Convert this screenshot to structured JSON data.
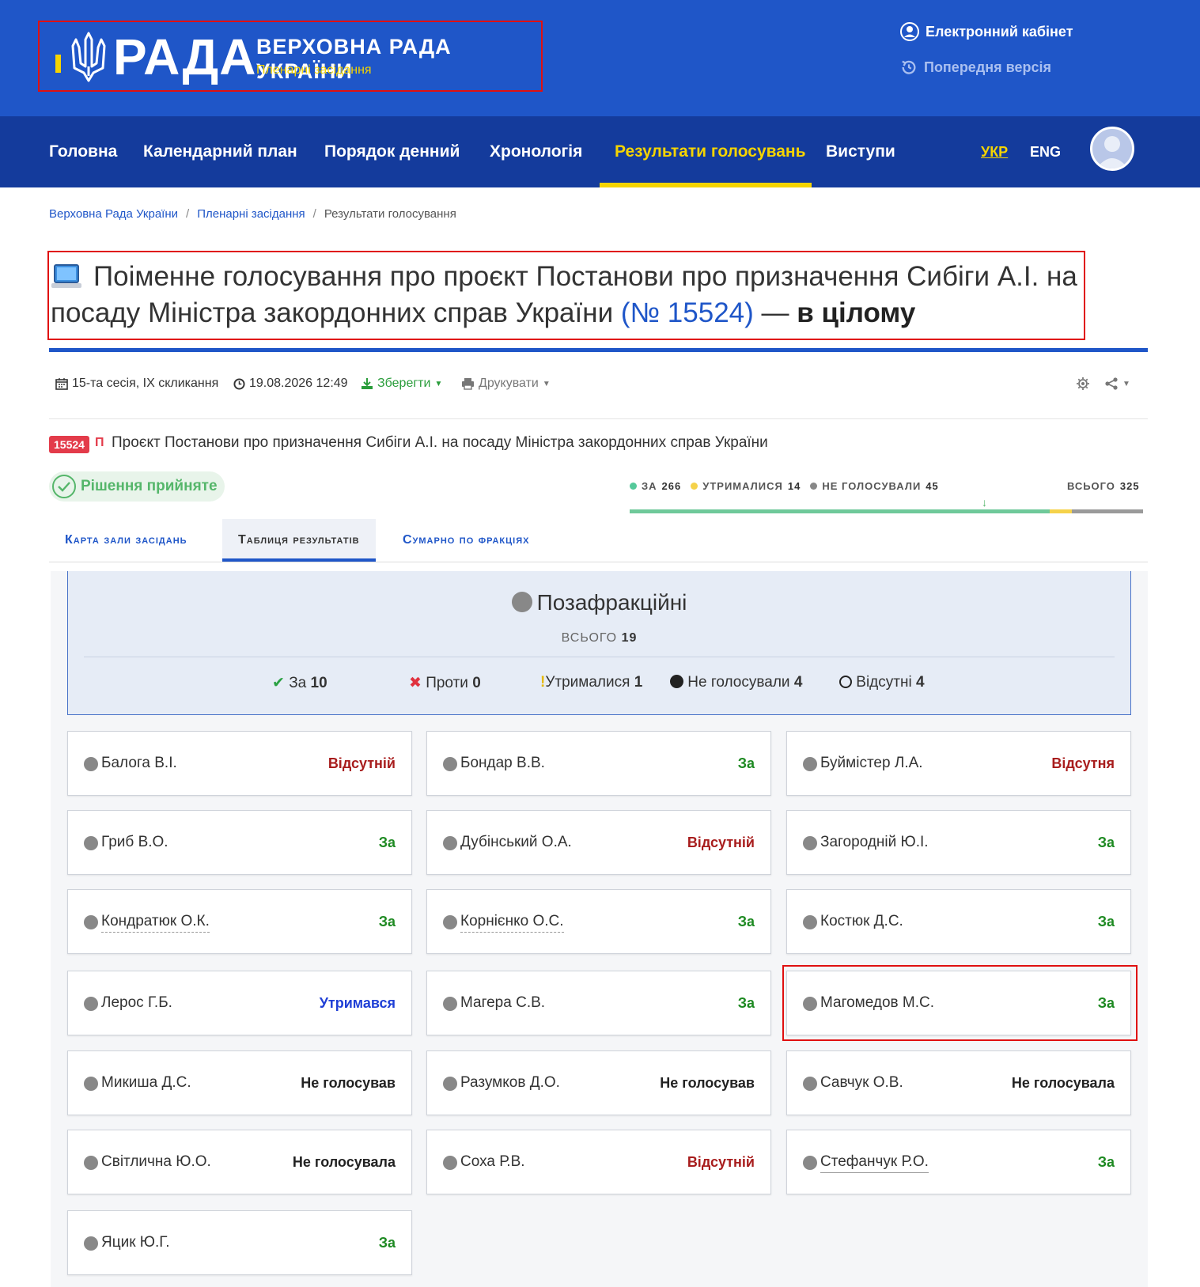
{
  "header": {
    "logo_text": "РАДА",
    "org_name": "ВЕРХОВНА РАДА УКРАЇНИ",
    "section": "Пленарні засідання",
    "ecabinet": "Електронний кабінет",
    "previous_version": "Попередня версія"
  },
  "nav": {
    "items": [
      "Головна",
      "Календарний план",
      "Порядок денний",
      "Хронологія",
      "Результати голосувань",
      "Виступи"
    ],
    "active": "Результати голосувань",
    "lang_ua": "УКР",
    "lang_en": "ENG"
  },
  "breadcrumb": [
    "Верховна Рада України",
    "Пленарні засідання",
    "Результати голосування"
  ],
  "title": {
    "main": "Поіменне голосування про проєкт Постанови про призначення Сибіги А.І. на посаду Міністра закордонних справ України",
    "number": "(№ 15524)",
    "dash": "—",
    "suffix": "в цілому"
  },
  "meta": {
    "session": "15-та сесія, IX скликання",
    "datetime": "19.08.2026 12:49",
    "save": "Зберегти",
    "print": "Друкувати"
  },
  "bill": {
    "badge": "15524",
    "type_letter": "П",
    "text": "Проєкт Постанови про призначення Сибіги А.І. на посаду Міністра закордонних справ України"
  },
  "decision": "Рішення прийняте",
  "stats": {
    "za_label": "ЗА",
    "za": 266,
    "utr_label": "УТРИМАЛИСЯ",
    "utr": 14,
    "nv_label": "НЕ ГОЛОСУВАЛИ",
    "nv": 45,
    "total_label": "ВСЬОГО",
    "total": 325
  },
  "tabs": [
    "Карта зали засідань",
    "Таблиця результатів",
    "Сумарно по фракціях"
  ],
  "faction": {
    "name": "Позафракційні",
    "total_label": "ВСЬОГО",
    "total": "19",
    "za_label": "За",
    "za": "10",
    "proty_label": "Проти",
    "proty": "0",
    "utr_label": "Утрималися",
    "utr": "1",
    "nv_label": "Не голосували",
    "nv": "4",
    "vid_label": "Відсутні",
    "vid": "4"
  },
  "deputies": [
    {
      "name": "Балога В.І.",
      "status": "Відсутній"
    },
    {
      "name": "Бондар В.В.",
      "status": "За"
    },
    {
      "name": "Буймістер Л.А.",
      "status": "Відсутня"
    },
    {
      "name": "Гриб В.О.",
      "status": "За"
    },
    {
      "name": "Дубінський О.А.",
      "status": "Відсутній"
    },
    {
      "name": "Загородній Ю.І.",
      "status": "За"
    },
    {
      "name": "Кондратюк О.К.",
      "status": "За"
    },
    {
      "name": "Корнієнко О.С.",
      "status": "За"
    },
    {
      "name": "Костюк Д.С.",
      "status": "За"
    },
    {
      "name": "Лерос Г.Б.",
      "status": "Утримався"
    },
    {
      "name": "Магера С.В.",
      "status": "За"
    },
    {
      "name": "Магомедов М.С.",
      "status": "За"
    },
    {
      "name": "Микиша Д.С.",
      "status": "Не голосував"
    },
    {
      "name": "Разумков Д.О.",
      "status": "Не голосував"
    },
    {
      "name": "Савчук О.В.",
      "status": "Не голосувала"
    },
    {
      "name": "Світлична Ю.О.",
      "status": "Не голосувала"
    },
    {
      "name": "Соха Р.В.",
      "status": "Відсутній"
    },
    {
      "name": "Стефанчук Р.О.",
      "status": "За"
    },
    {
      "name": "Яцик Ю.Г.",
      "status": "За"
    }
  ],
  "colors": {
    "brand_blue": "#1f56c8",
    "nav_blue": "#143b9c",
    "accent_yellow": "#f5d400",
    "za_green": "#1e8a22",
    "absent_red": "#a81d1d",
    "abstain_blue": "#1f3fd6"
  }
}
